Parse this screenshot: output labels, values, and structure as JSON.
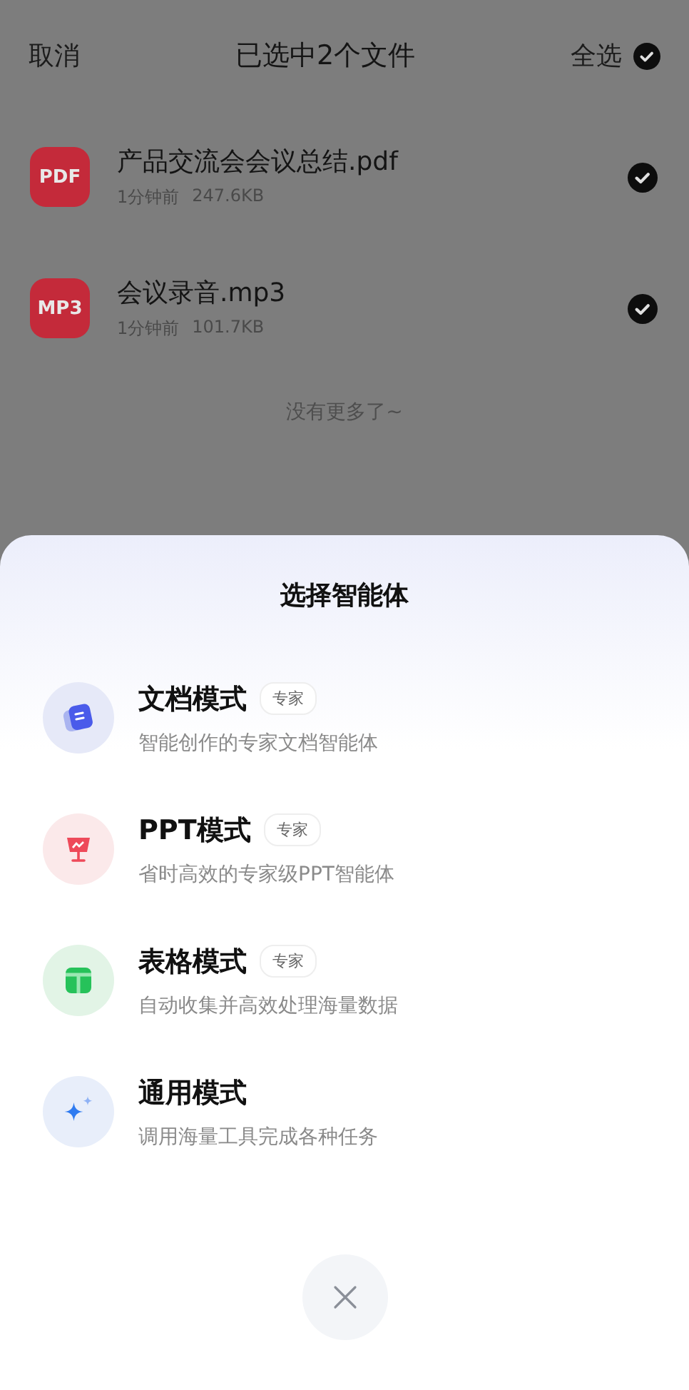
{
  "header": {
    "cancel": "取消",
    "title": "已选中2个文件",
    "select_all": {
      "label": "全选",
      "checked": true
    }
  },
  "files": [
    {
      "badge": "PDF",
      "name": "产品交流会会议总结.pdf",
      "time": "1分钟前",
      "size": "247.6KB",
      "selected": true
    },
    {
      "badge": "MP3",
      "name": "会议录音.mp3",
      "time": "1分钟前",
      "size": "101.7KB",
      "selected": true
    }
  ],
  "end_note": "没有更多了~",
  "sheet": {
    "title": "选择智能体",
    "modes": [
      {
        "kind": "doc",
        "title": "文档模式",
        "tag": "专家",
        "subtitle": "智能创作的专家文档智能体"
      },
      {
        "kind": "ppt",
        "title": "PPT模式",
        "tag": "专家",
        "subtitle": "省时高效的专家级PPT智能体"
      },
      {
        "kind": "sheet",
        "title": "表格模式",
        "tag": "专家",
        "subtitle": "自动收集并高效处理海量数据"
      },
      {
        "kind": "general",
        "title": "通用模式",
        "subtitle": "调用海量工具完成各种任务"
      }
    ]
  }
}
